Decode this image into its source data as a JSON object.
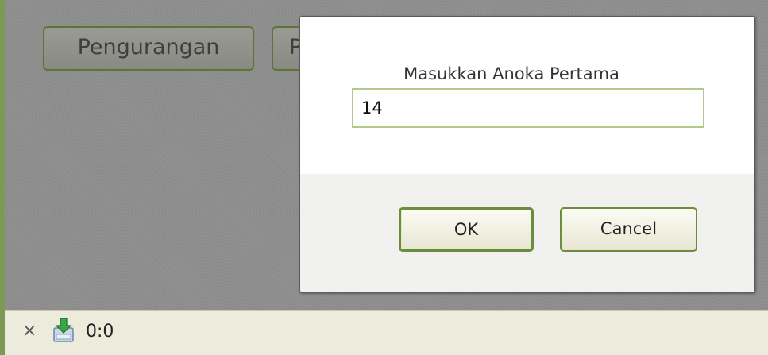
{
  "background": {
    "buttons": [
      "Pengurangan",
      "P"
    ]
  },
  "dialog": {
    "prompt": "Masukkan Anoka Pertama",
    "input_value": "14",
    "ok_label": "OK",
    "cancel_label": "Cancel"
  },
  "status_bar": {
    "close_symbol": "×",
    "download_icon": "download-tray-icon",
    "text": "0:0"
  },
  "colors": {
    "accent_green": "#6b8e3c",
    "overlay_grey": "#8f8f8f",
    "status_bar_bg": "#ecebdc"
  }
}
